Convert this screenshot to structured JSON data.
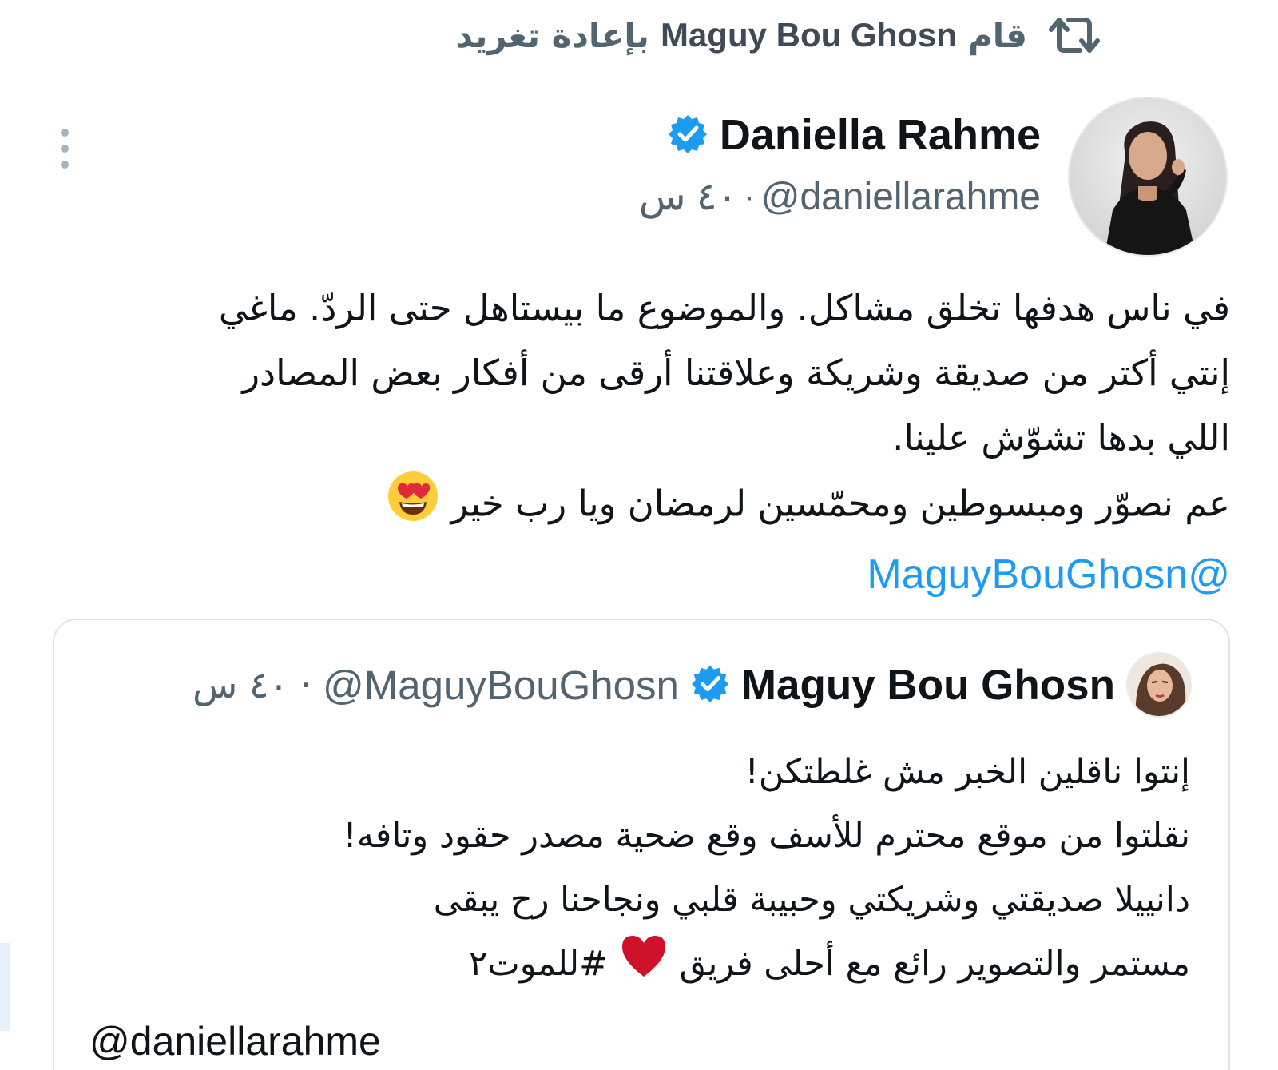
{
  "retweet": {
    "prefix": "قام",
    "name": "Maguy Bou Ghosn",
    "suffix": "بإعادة تغريد"
  },
  "tweet": {
    "author_name": "Daniella Rahme",
    "handle": "@daniellarahme",
    "separator": "·",
    "time": "٤٠ س",
    "body_lines": [
      "في ناس هدفها تخلق مشاكل. والموضوع ما بيستاهل حتى الردّ. ماغي",
      "إنتي أكتر من صديقة وشريكة وعلاقتنا أرقى من أفكار بعض المصادر",
      "اللي بدها تشوّش علينا.",
      "عم نصوّر ومبسوطين ومحمّسين لرمضان ويا رب خير"
    ],
    "mention": "@MaguyBouGhosn"
  },
  "quoted": {
    "author_name": "Maguy Bou Ghosn",
    "handle": "@MaguyBouGhosn",
    "separator": "·",
    "time": "٤٠ س",
    "body_lines": [
      "إنتوا ناقلين الخبر مش غلطتكن!",
      "نقلتوا من موقع محترم للأسف وقع ضحية مصدر حقود وتافه!",
      "دانييلا صديقتي وشريكتي وحبيبة قلبي ونجاحنا رح يبقى"
    ],
    "last_line_start": "مستمر والتصوير رائع مع أحلى فريق",
    "hashtag": "#للموت٢",
    "mention": "@daniellarahme"
  },
  "colors": {
    "link": "#1d9bf0",
    "verified": "#1d9bf0",
    "muted": "#536471",
    "heart": "#d0112b"
  },
  "icons": {
    "retweet": "retweet-icon",
    "verified": "verified-badge-icon",
    "more": "more-vertical-icon",
    "emoji": "heart-eyes-emoji",
    "heart": "red-heart-emoji"
  }
}
